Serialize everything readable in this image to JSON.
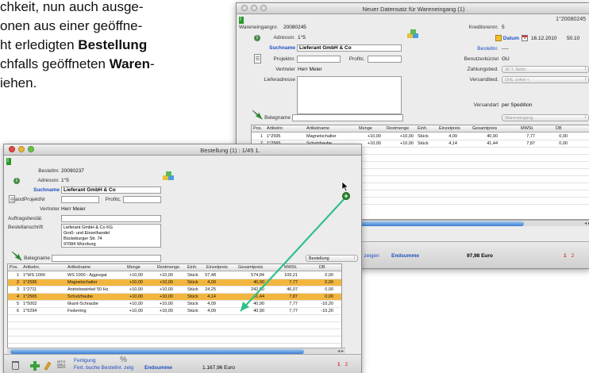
{
  "doc_text": {
    "l1": "chkeit, nun auch ausge-",
    "l2": "onen aus einer geöffne-",
    "l3_pre": "ht erledigten ",
    "l3_bold": "Bestellung",
    "l4_pre": "chfalls geöffneten ",
    "l4_bold": "Waren",
    "l4_post": "-",
    "l5": "iehen."
  },
  "win_we": {
    "title": "Neuer Datensatz für Wareneingang (1)",
    "title_right": "1°20080245",
    "wareneingangnr_label": "Wareneingangnr.",
    "wareneingangnr": "20080245",
    "adressnr_label": "Adressnr.",
    "adressnr": "1°5",
    "suchname_label": "Suchname",
    "suchname": "Lieferant GmbH & Co",
    "projektnr_label": "Projektnr.",
    "profitc_label": "Profitc.",
    "vertreter_label": "Vertreter",
    "vertreter": "Herr Meier",
    "lieferadresse_label": "Lieferadresse",
    "kreditorennr_label": "Kreditorennr.",
    "kreditorennr": "5",
    "datum_label": "Datum",
    "datum": "16.12.2010",
    "datum_extra": "50.10",
    "bestellnr_label": "Bestellnr.",
    "bestellnr": "----",
    "benutzer_label": "Benutzerkürzel",
    "benutzer": "GU",
    "zahlungsbed_label": "Zahlungsbed.",
    "zahlungsbed": "30 T. Netto",
    "versandbed_label": "Versandbed.",
    "versandbed": "OHL unfrei <",
    "versandart_label": "Versandart",
    "versandart": "per Spedition",
    "belegname_label": "Belegname",
    "belegname": "Wareneingang",
    "columns": [
      "Pos.",
      "Artikelnr.",
      "Artikelname",
      "Menge",
      "Restmenge",
      "Einh.",
      "Einzelpreis",
      "Gesamtpreis",
      "MWSt.",
      "DB"
    ],
    "rows": [
      [
        "1",
        "1°2595",
        "Magnetschalter",
        "+10,00",
        "+10,00",
        "Stück",
        "4,09",
        "40,90",
        "7,77",
        "0,00"
      ],
      [
        "2",
        "1°2565",
        "Schutzhaube",
        "+10,00",
        "+10,00",
        "Stück",
        "4,14",
        "41,44",
        "7,87",
        "0,00"
      ]
    ],
    "bar_link": "Bestellnr. zeigen",
    "bar_endsumme": "Endsumme",
    "bar_total": "97,98",
    "bar_currency": "Euro",
    "barcode": "SKTCS\nEPRLS\nZGHYX",
    "page_a": "1",
    "page_b": "2"
  },
  "win_be": {
    "title": "Bestellung (1) : 1/45 1.",
    "bestellnr_label": "Bestellnr.",
    "bestellnr": "20090237",
    "adressnr_label": "Adressnr.",
    "adressnr": "1°5",
    "suchname_label": "Suchname",
    "suchname": "Lieferant GmbH & Co",
    "projektnr_label": "andProjektNr",
    "profitc_label": "Profitc.",
    "vertreter_label": "Vertreter",
    "vertreter": "Herr Meier",
    "auftrag_label": "Auftragsbestät.",
    "anschrift_label": "Bestellanschrift",
    "anschrift": [
      "Lieferant GmbH & Co KG",
      "Groß- und Einzelhandel",
      "Bückeburger Str. 74",
      "97084 Würzburg"
    ],
    "belegname_label": "Belegname",
    "belegname": "Bestellung",
    "columns": [
      "Pos.",
      "Artikelnr.",
      "Artikelname",
      "Menge",
      "Restmenge",
      "Einh.",
      "Einzelpreis",
      "Gesamtpreis",
      "MWSt.",
      "DB"
    ],
    "rows": [
      [
        "1",
        "1°WS 1000",
        "WS 1000 - Aggregat",
        "+10,00",
        "+10,00",
        "Stück",
        "57,48",
        "574,84",
        "109,21",
        "0,00"
      ],
      [
        "2",
        "1°2595",
        "Magnetschalter",
        "+10,00",
        "+10,00",
        "Stück",
        "4,09",
        "40,90",
        "7,77",
        "0,00"
      ],
      [
        "3",
        "1°2711",
        "Antriebswinkel 50 Hz",
        "+10,00",
        "+10,00",
        "Stück",
        "24,25",
        "242,50",
        "46,07",
        "0,00"
      ],
      [
        "4",
        "1°2565",
        "Schutzhaube",
        "+10,00",
        "+10,00",
        "Stück",
        "4,14",
        "41,44",
        "7,87",
        "0,00"
      ],
      [
        "5",
        "1°5002",
        "6kant-Schraube",
        "+10,00",
        "+10,00",
        "Stück",
        "4,09",
        "40,90",
        "7,77",
        "-10,20"
      ],
      [
        "6",
        "1°5294",
        "Federring",
        "+10,00",
        "+10,00",
        "Stück",
        "4,09",
        "40,90",
        "7,77",
        "-10,20"
      ]
    ],
    "highlight_rows": [
      1,
      3
    ],
    "bar_fertigung": "Fertigung",
    "bar_links": "Fert. buche Bestellnr. zeig",
    "bar_endsumme": "Endsumme",
    "bar_total": "1.167,96",
    "bar_currency": "Euro",
    "barcode": "SKTCS\nEPRLS\nZGHYX",
    "page_a": "1",
    "page_b": "2"
  },
  "colors": {
    "highlight": "#f2b640",
    "link": "#1d4fc4",
    "arrow": "#2fc08a",
    "page": "#d22222"
  }
}
